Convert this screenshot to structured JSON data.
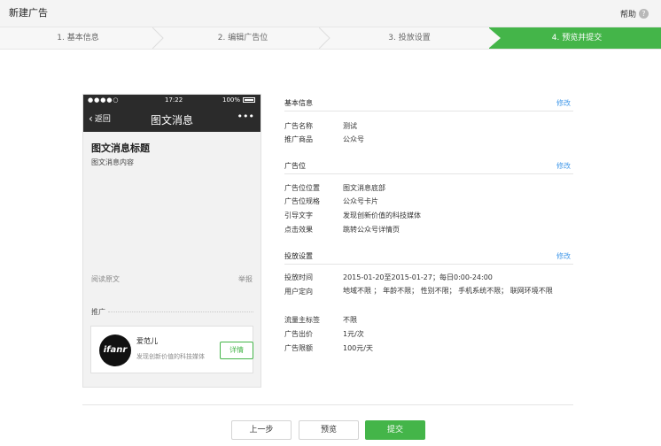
{
  "header": {
    "title": "新建广告",
    "help_label": "帮助",
    "help_icon": "?"
  },
  "steps": [
    {
      "label": "1. 基本信息",
      "active": false
    },
    {
      "label": "2. 编辑广告位",
      "active": false
    },
    {
      "label": "3. 投放设置",
      "active": false
    },
    {
      "label": "4. 预览并提交",
      "active": true
    }
  ],
  "accent_color": "#44b549",
  "link_color": "#459ae9",
  "phone": {
    "status": {
      "signal": "●●●●○",
      "time": "17:22",
      "battery": "100%"
    },
    "nav": {
      "back_label": "返回",
      "title": "图文消息",
      "more": "•••"
    },
    "article_title": "图文消息标题",
    "article_content": "图文消息内容",
    "read_original": "阅读原文",
    "report": "举报",
    "promo_label": "推广",
    "ad_card": {
      "avatar_text": "ifanr",
      "name": "爱范儿",
      "desc": "发现创新价值的科技媒体",
      "button": "详情"
    }
  },
  "sections": {
    "basic": {
      "title": "基本信息",
      "edit": "修改",
      "rows": [
        {
          "label": "广告名称",
          "value": "测试"
        },
        {
          "label": "推广商品",
          "value": "公众号"
        }
      ]
    },
    "slot": {
      "title": "广告位",
      "edit": "修改",
      "rows": [
        {
          "label": "广告位位置",
          "value": "图文消息底部"
        },
        {
          "label": "广告位规格",
          "value": "公众号卡片"
        },
        {
          "label": "引导文字",
          "value": "发现创新价值的科技媒体"
        },
        {
          "label": "点击效果",
          "value": "跳转公众号详情页"
        }
      ]
    },
    "delivery": {
      "title": "投放设置",
      "edit": "修改",
      "rows": [
        {
          "label": "投放时间",
          "value": "2015-01-20至2015-01-27；每日0:00-24:00"
        },
        {
          "label": "用户定向",
          "value": "地域不限 ； 年龄不限； 性别不限； 手机系统不限； 联网环境不限"
        },
        {
          "label": "流量主标签",
          "value": "不限"
        },
        {
          "label": "广告出价",
          "value": "1元/次"
        },
        {
          "label": "广告限额",
          "value": "100元/天"
        }
      ]
    }
  },
  "footer": {
    "prev": "上一步",
    "preview": "预览",
    "submit": "提交"
  }
}
